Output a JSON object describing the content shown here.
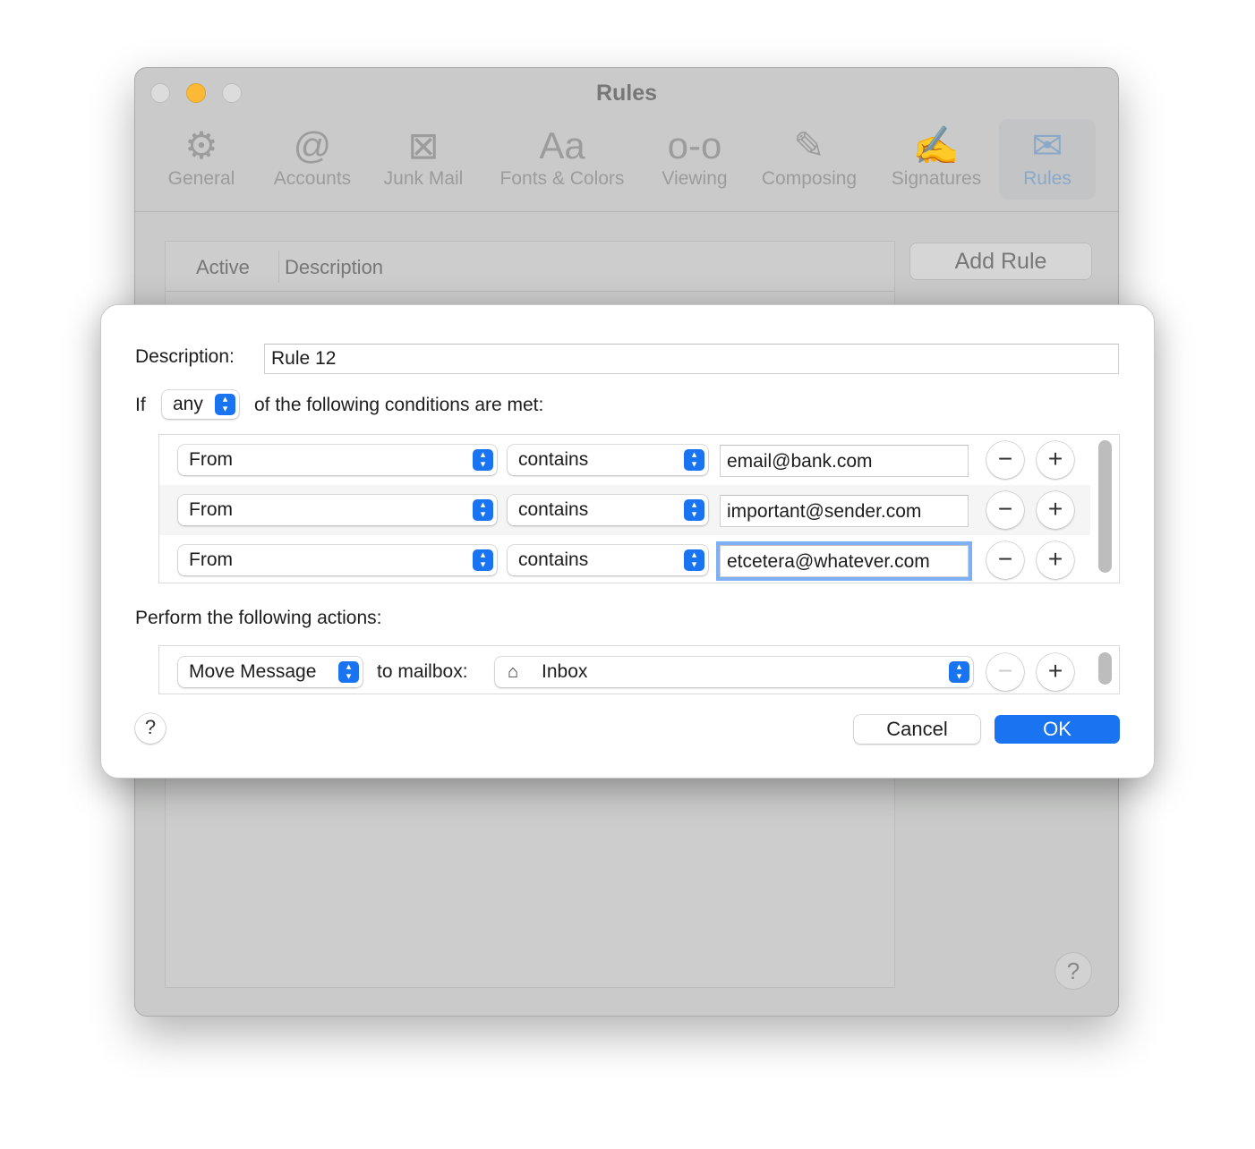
{
  "window": {
    "title": "Rules"
  },
  "toolbar": [
    {
      "label": "General",
      "icon": "gear-icon",
      "glyph": "⚙"
    },
    {
      "label": "Accounts",
      "icon": "at-icon",
      "glyph": "@"
    },
    {
      "label": "Junk Mail",
      "icon": "junk-bin-icon",
      "glyph": "⊠"
    },
    {
      "label": "Fonts & Colors",
      "icon": "fonts-icon",
      "glyph": "Aa"
    },
    {
      "label": "Viewing",
      "icon": "glasses-icon",
      "glyph": "o-o"
    },
    {
      "label": "Composing",
      "icon": "compose-icon",
      "glyph": "✎"
    },
    {
      "label": "Signatures",
      "icon": "signature-icon",
      "glyph": "✍"
    },
    {
      "label": "Rules",
      "icon": "rules-envelope-icon",
      "glyph": "✉",
      "selected": true
    }
  ],
  "rules_list": {
    "columns": [
      "Active",
      "Description"
    ],
    "add_rule": "Add Rule",
    "help": "?"
  },
  "sheet": {
    "description_label": "Description:",
    "description_value": "Rule 12",
    "if_label": "If",
    "match_value": "any",
    "match_suffix": "of the following conditions are met:",
    "conditions": [
      {
        "field": "From",
        "operator": "contains",
        "value": "email@bank.com"
      },
      {
        "field": "From",
        "operator": "contains",
        "value": "important@sender.com"
      },
      {
        "field": "From",
        "operator": "contains",
        "value": "etcetera@whatever.com",
        "focused": true
      }
    ],
    "actions_label": "Perform the following actions:",
    "actions": [
      {
        "action": "Move Message",
        "target_label": "to mailbox:",
        "mailbox": "Inbox",
        "mailbox_icon": "inbox-tray-icon"
      }
    ],
    "help": "?",
    "cancel": "Cancel",
    "ok": "OK"
  },
  "colors": {
    "accent": "#1a73f0",
    "focus_ring": "#7fb0f5"
  }
}
